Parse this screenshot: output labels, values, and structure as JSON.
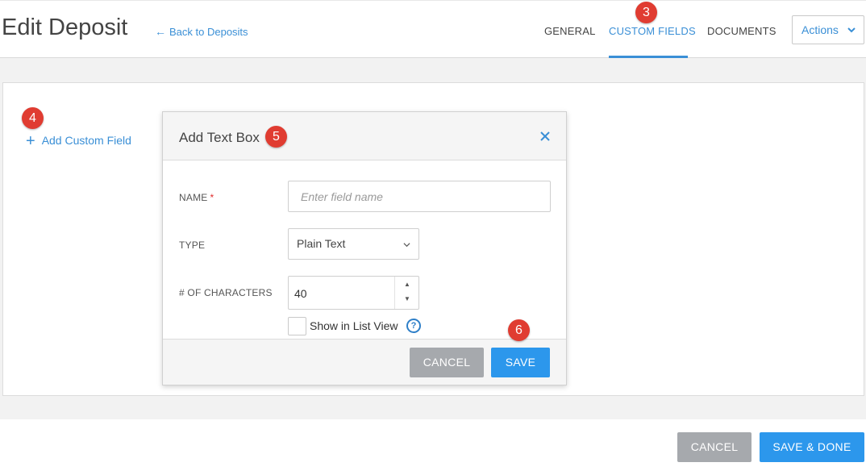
{
  "header": {
    "title": "Edit Deposit",
    "back_link": "Back to Deposits",
    "tabs": [
      {
        "label": "GENERAL",
        "active": false
      },
      {
        "label": "CUSTOM FIELDS",
        "active": true
      },
      {
        "label": "DOCUMENTS",
        "active": false
      }
    ],
    "actions_label": "Actions"
  },
  "sidebar": {
    "add_custom_field": "Add Custom Field"
  },
  "modal": {
    "title": "Add Text Box",
    "name_label": "NAME",
    "required_mark": "*",
    "name_placeholder": "Enter field name",
    "type_label": "TYPE",
    "type_value": "Plain Text",
    "chars_label": "# OF CHARACTERS",
    "chars_value": "40",
    "show_in_list_label": "Show in List View",
    "show_in_list_checked": false,
    "help_glyph": "?",
    "cancel_label": "CANCEL",
    "save_label": "SAVE"
  },
  "footer": {
    "cancel_label": "CANCEL",
    "save_done_label": "SAVE & DONE"
  },
  "markers": [
    "3",
    "4",
    "5",
    "6"
  ],
  "colors": {
    "accent": "#3a8fd6",
    "primary_button": "#2c97ec",
    "secondary_button": "#a6a9ad",
    "marker": "#e03c31"
  }
}
